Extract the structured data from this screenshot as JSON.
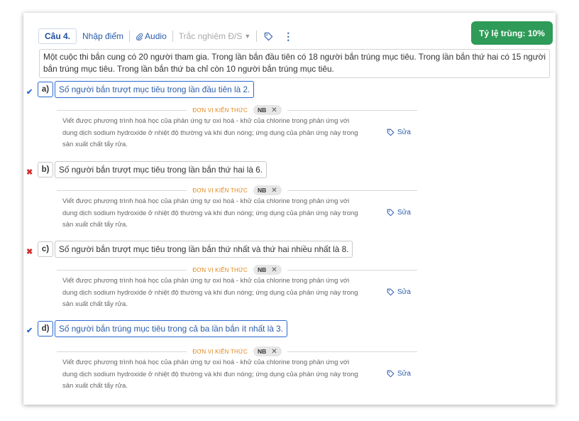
{
  "toolbar": {
    "question_label": "Câu 4.",
    "enter_score": "Nhập điểm",
    "audio": "Audio",
    "question_type": "Trắc nghiệm Đ/S"
  },
  "match_badge": "Tỷ lệ trùng: 10%",
  "stem": "Một cuộc thi bắn cung có 20 người tham gia. Trong lần bắn đầu tiên có 18 người bắn trúng mục tiêu. Trong lần bắn thứ hai có 15 người bắn trúng mục tiêu. Trong lần bắn thứ ba chỉ còn 10 người bắn trúng mục tiêu.",
  "knowledge_label": "ĐƠN VỊ KIẾN THỨC",
  "edit_label": "Sửa",
  "colors": {
    "accent": "#2a6ad0",
    "wrong": "#d32f2f",
    "badge": "#2e9b58",
    "knowledge": "#e0861a"
  },
  "items": [
    {
      "letter": "a)",
      "mark": "✔",
      "mark_type": "correct",
      "statement": "Số người bắn trượt mục tiêu trong lần đầu tiên là 2.",
      "level": "NB",
      "desc": [
        "Viết được phương trình hoá học của phản ứng tự oxi hoá - khử của chlorine trong phản ứng với",
        "dung dịch sodium hydroxide ở nhiệt độ thường và khi đun nóng; ứng dụng của phản ứng này trong",
        "sản xuất chất tẩy rửa."
      ]
    },
    {
      "letter": "b)",
      "mark": "✖",
      "mark_type": "wrong",
      "statement": "Số người bắn trượt mục tiêu trong lần bắn thứ hai là 6.",
      "level": "NB",
      "desc": [
        "Viết được phương trình hoá học của phản ứng tự oxi hoá - khử của chlorine trong phản ứng với",
        "dung dịch sodium hydroxide ở nhiệt độ thường và khi đun nóng; ứng dụng của phản ứng này trong",
        "sản xuất chất tẩy rửa."
      ]
    },
    {
      "letter": "c)",
      "mark": "✖",
      "mark_type": "wrong",
      "statement": "Số người bắn trượt mục tiêu trong lần bắn thứ nhất và thứ hai nhiều nhất là 8.",
      "level": "NB",
      "desc": [
        "Viết được phương trình hoá học của phản ứng tự oxi hoá - khử của chlorine trong phản ứng với",
        "dung dịch sodium hydroxide ở nhiệt độ thường và khi đun nóng; ứng dụng của phản ứng này trong",
        "sản xuất chất tẩy rửa."
      ]
    },
    {
      "letter": "d)",
      "mark": "✔",
      "mark_type": "correct",
      "statement": "Số người bắn trúng mục tiêu trong cả ba lần bắn ít nhất là 3.",
      "level": "NB",
      "desc": [
        "Viết được phương trình hoá học của phản ứng tự oxi hoá - khử của chlorine trong phản ứng với",
        "dung dịch sodium hydroxide ở nhiệt độ thường và khi đun nóng; ứng dụng của phản ứng này trong",
        "sản xuất chất tẩy rửa."
      ]
    }
  ]
}
